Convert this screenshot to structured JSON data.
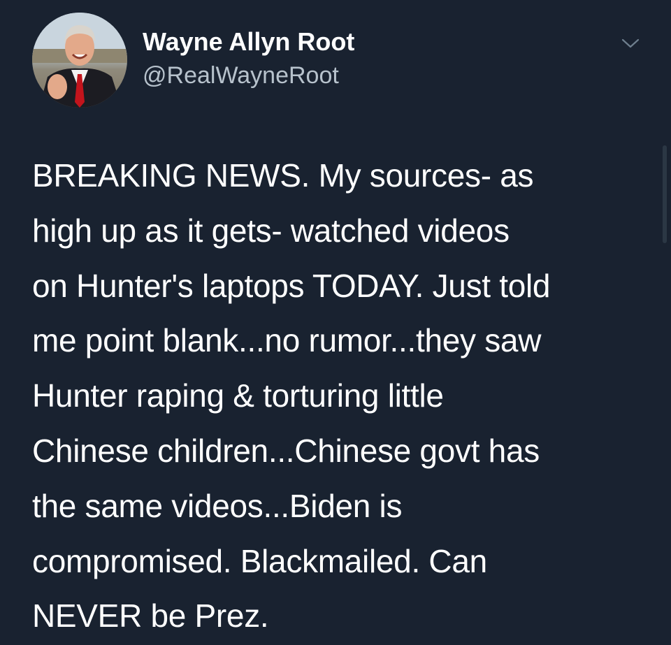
{
  "author": {
    "display_name": "Wayne Allyn Root",
    "handle": "@RealWayneRoot",
    "avatar_icon": "profile-photo-avatar"
  },
  "menu": {
    "icon": "chevron-down-icon"
  },
  "tweet": {
    "lines": [
      "BREAKING NEWS. My sources- as",
      "high up as it gets- watched videos",
      "on Hunter's laptops TODAY. Just told",
      "me point blank...no rumor...they saw",
      "Hunter raping & torturing little",
      "Chinese children...Chinese govt has",
      "the same videos...Biden is",
      "compromised. Blackmailed. Can",
      "NEVER be Prez."
    ]
  },
  "colors": {
    "background": "#192230",
    "text": "#ffffff",
    "handle": "#b7c2cc"
  }
}
